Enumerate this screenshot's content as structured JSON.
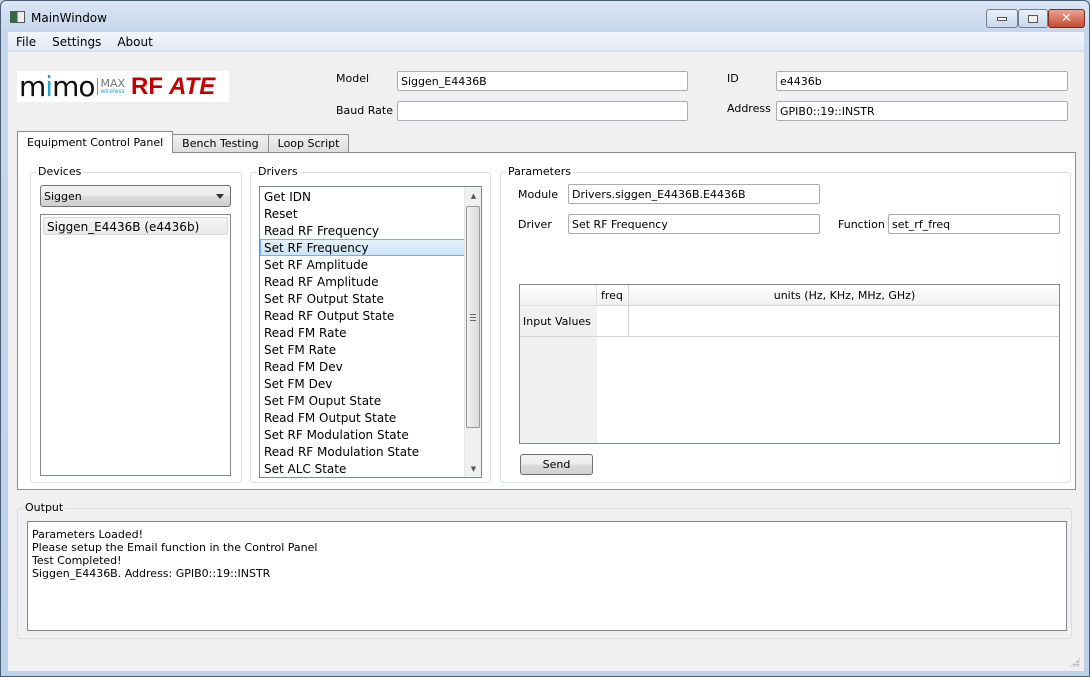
{
  "window": {
    "title": "MainWindow",
    "controls": {
      "minimize": "minimize",
      "maximize": "maximize",
      "close": "close"
    }
  },
  "menu": {
    "items": [
      "File",
      "Settings",
      "About"
    ]
  },
  "logo": {
    "mimo": "mimo",
    "max": "MAX",
    "wireless": "wireless",
    "rf": "RF",
    "ate": "ATE"
  },
  "header": {
    "model_label": "Model",
    "model_value": "Siggen_E4436B",
    "baud_label": "Baud Rate",
    "baud_value": "",
    "id_label": "ID",
    "id_value": "e4436b",
    "address_label": "Address",
    "address_value": "GPIB0::19::INSTR"
  },
  "tabs": [
    {
      "label": "Equipment Control Panel",
      "active": true
    },
    {
      "label": "Bench Testing",
      "active": false
    },
    {
      "label": "Loop Script",
      "active": false
    }
  ],
  "devices": {
    "title": "Devices",
    "selected_type": "Siggen",
    "items": [
      "Siggen_E4436B (e4436b)"
    ]
  },
  "drivers": {
    "title": "Drivers",
    "selected": "Set RF Frequency",
    "items": [
      "Get IDN",
      "Reset",
      "Read RF Frequency",
      "Set RF Frequency",
      "Set RF Amplitude",
      "Read RF Amplitude",
      "Set RF Output State",
      "Read RF Output State",
      "Read FM Rate",
      "Set FM Rate",
      "Read FM Dev",
      "Set FM Dev",
      "Set FM Ouput State",
      "Read FM Output State",
      "Set RF Modulation State",
      "Read RF Modulation State",
      "Set ALC State"
    ]
  },
  "parameters": {
    "title": "Parameters",
    "module_label": "Module",
    "module_value": "Drivers.siggen_E4436B.E4436B",
    "driver_label": "Driver",
    "driver_value": "Set RF Frequency",
    "function_label": "Function",
    "function_value": "set_rf_freq",
    "table": {
      "columns": [
        "freq",
        "units (Hz, KHz, MHz, GHz)"
      ],
      "rows": [
        {
          "header": "Input Values",
          "cells": [
            "",
            ""
          ]
        }
      ]
    },
    "send_label": "Send"
  },
  "output": {
    "title": "Output",
    "lines": [
      "Parameters Loaded!",
      "Please setup the Email function in the Control Panel",
      "Test Completed!",
      "Siggen_E4436B. Address: GPIB0::19::INSTR"
    ]
  }
}
